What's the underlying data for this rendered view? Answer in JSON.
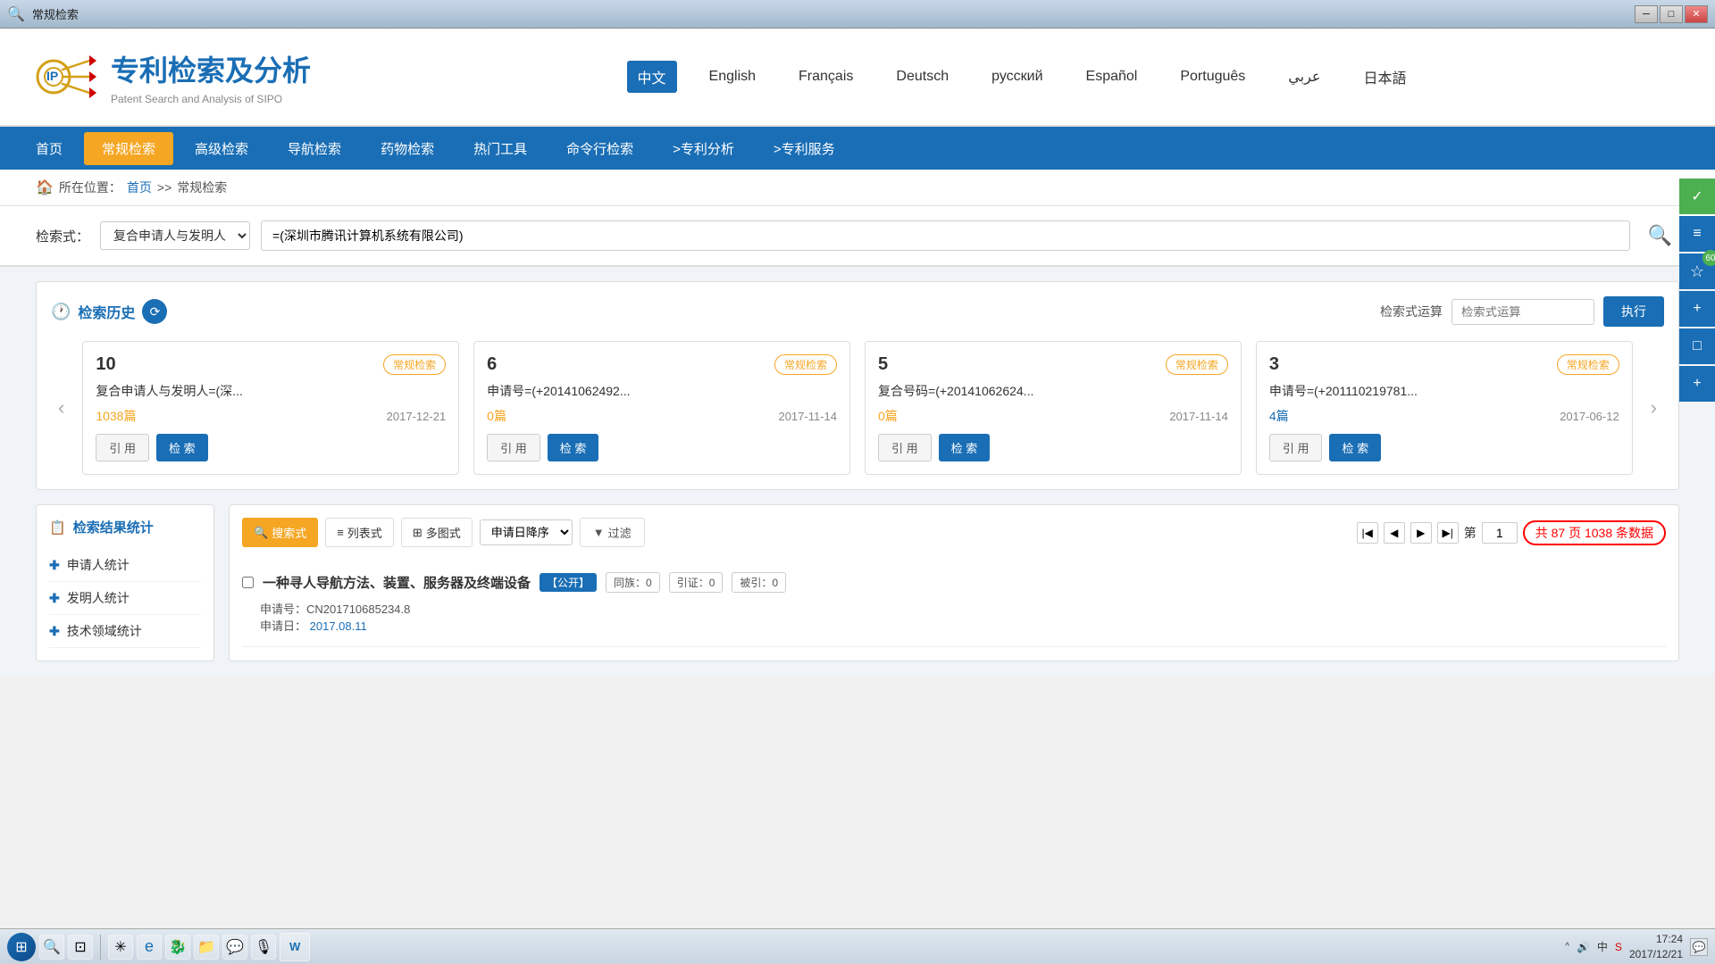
{
  "titlebar": {
    "title": "常规检索",
    "controls": [
      "minimize",
      "maximize",
      "close"
    ]
  },
  "header": {
    "logo_cn": "专利检索及分析",
    "logo_en": "Patent Search and Analysis of SIPO",
    "languages": [
      "中文",
      "English",
      "Français",
      "Deutsch",
      "русский",
      "Español",
      "Português",
      "عربي",
      "日本語"
    ],
    "active_lang": "中文"
  },
  "nav": {
    "items": [
      "首页",
      "常规检索",
      "高级检索",
      "导航检索",
      "药物检索",
      "热门工具",
      "命令行检索",
      ">专利分析",
      ">专利服务"
    ],
    "active": "常规检索"
  },
  "breadcrumb": {
    "home": "首页",
    "separator": ">>",
    "current": "常规检索",
    "prefix": "所在位置："
  },
  "search": {
    "label": "检索式：",
    "select_value": "复合申请人与发明人",
    "input_value": "=(深圳市腾讯计算机系统有限公司)",
    "search_btn_title": "搜索"
  },
  "history_section": {
    "title": "检索历史",
    "ops_label": "检索式运算",
    "ops_placeholder": "检索式运算",
    "exec_label": "执行",
    "cards": [
      {
        "num": "10",
        "tag": "常规检索",
        "query": "复合申请人与发明人=(深...",
        "count": "1038篇",
        "count_type": "orange",
        "date": "2017-12-21",
        "btn_quote": "引用",
        "btn_search": "检索"
      },
      {
        "num": "6",
        "tag": "常规检索",
        "query": "申请号=(+20141062492...",
        "count": "0篇",
        "count_type": "orange",
        "date": "2017-11-14",
        "btn_quote": "引用",
        "btn_search": "检索"
      },
      {
        "num": "5",
        "tag": "常规检索",
        "query": "复合号码=(+20141062624...",
        "count": "0篇",
        "count_type": "orange",
        "date": "2017-11-14",
        "btn_quote": "引用",
        "btn_search": "检索"
      },
      {
        "num": "3",
        "tag": "常规检索",
        "query": "申请号=(+201110219781...",
        "count": "4篇",
        "count_type": "blue",
        "date": "2017-06-12",
        "btn_quote": "引用",
        "btn_search": "检索"
      }
    ]
  },
  "left_panel": {
    "title": "检索结果统计",
    "items": [
      "申请人统计",
      "发明人统计",
      "技术领域统计"
    ]
  },
  "results": {
    "toolbar": {
      "search_mode": "搜索式",
      "list_mode": "列表式",
      "multi_mode": "多图式",
      "sort_label": "申请日降序",
      "filter_label": "过滤",
      "page_current": "1",
      "page_total": "87",
      "records_total": "1038",
      "page_info": "共 87 页 1038 条数据"
    },
    "items": [
      {
        "title": "一种寻人导航方法、装置、服务器及终端设备",
        "badge": "【公开】",
        "stat1_label": "同族：",
        "stat1_val": "0",
        "stat2_label": "引证：",
        "stat2_val": "0",
        "stat3_label": "被引：",
        "stat3_val": "0",
        "app_no_label": "申请号：",
        "app_no": "CN201710685234.8",
        "app_date_label": "申请日：",
        "app_date": "2017.08.11"
      }
    ]
  },
  "right_sidebar": {
    "btns": [
      "✓",
      "≡",
      "☆",
      "+",
      "□",
      "+"
    ]
  },
  "taskbar": {
    "apps": [
      "🖥",
      "🔍",
      "🖼",
      "🔄",
      "🌐",
      "🐉",
      "📁",
      "💬",
      "🎙",
      "W"
    ],
    "system_tray": {
      "indicators": [
        "^",
        "🔊",
        "中",
        "S"
      ],
      "time": "17:24",
      "date": "2017/12/21"
    }
  }
}
